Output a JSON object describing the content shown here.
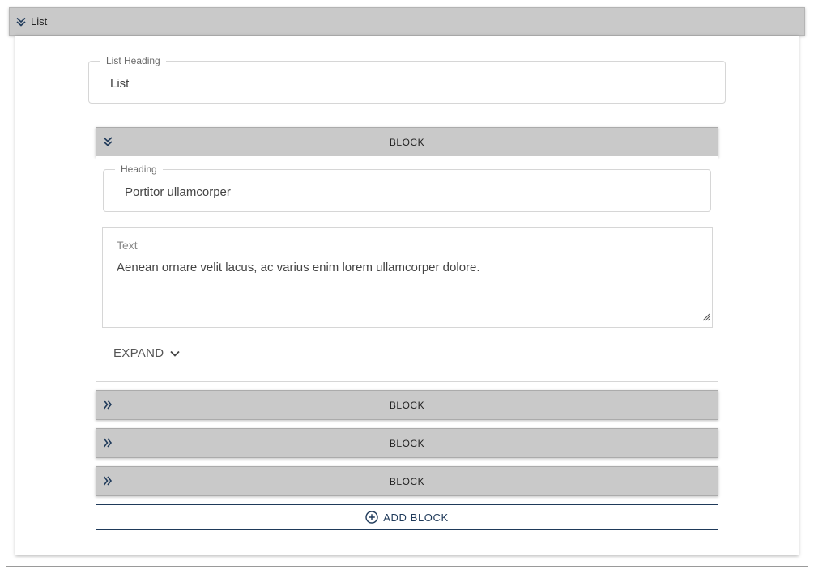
{
  "list_section": {
    "title": "List",
    "toggle_icon": "double-chevron-down-icon"
  },
  "list_heading_field": {
    "label": "List Heading",
    "value": "List"
  },
  "blocks": [
    {
      "title": "BLOCK",
      "expanded": true,
      "toggle_icon": "double-chevron-down-icon",
      "heading_field": {
        "label": "Heading",
        "value": "Portitor ullamcorper"
      },
      "text_field": {
        "label": "Text",
        "value": "Aenean ornare velit lacus, ac varius enim lorem ullamcorper dolore."
      },
      "expand_button": {
        "label": "EXPAND",
        "icon": "chevron-down-icon"
      }
    },
    {
      "title": "BLOCK",
      "expanded": false,
      "toggle_icon": "double-chevron-right-icon"
    },
    {
      "title": "BLOCK",
      "expanded": false,
      "toggle_icon": "double-chevron-right-icon"
    },
    {
      "title": "BLOCK",
      "expanded": false,
      "toggle_icon": "double-chevron-right-icon"
    }
  ],
  "add_block_button": {
    "label": "ADD BLOCK",
    "icon": "plus-circle-icon"
  },
  "colors": {
    "header_bg": "#c9c9c9",
    "accent": "#1f3a5a",
    "border": "#d6d6d6"
  }
}
